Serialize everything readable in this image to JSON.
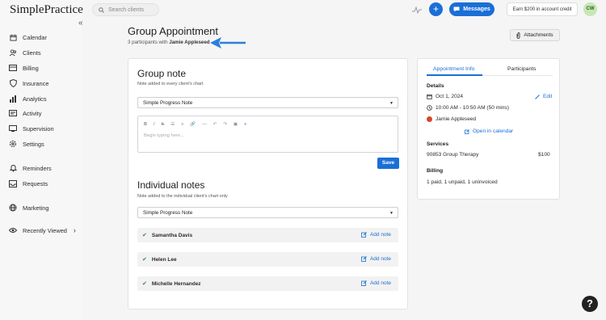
{
  "app": {
    "logo": "SimplePractice",
    "collapse_icon": "double-chevron-left-icon"
  },
  "sidebar": {
    "items": [
      {
        "label": "Calendar",
        "icon": "calendar-icon"
      },
      {
        "label": "Clients",
        "icon": "clients-icon"
      },
      {
        "label": "Billing",
        "icon": "billing-icon"
      },
      {
        "label": "Insurance",
        "icon": "shield-icon"
      },
      {
        "label": "Analytics",
        "icon": "analytics-icon"
      },
      {
        "label": "Activity",
        "icon": "activity-icon"
      },
      {
        "label": "Supervision",
        "icon": "supervision-icon"
      },
      {
        "label": "Settings",
        "icon": "gear-icon"
      },
      {
        "label": "Reminders",
        "icon": "bell-icon"
      },
      {
        "label": "Requests",
        "icon": "inbox-icon"
      },
      {
        "label": "Marketing",
        "icon": "globe-icon"
      },
      {
        "label": "Recently Viewed",
        "icon": "eye-icon"
      }
    ]
  },
  "topbar": {
    "search_placeholder": "Search clients",
    "plus_label": "+",
    "messages_label": "Messages",
    "earn_label": "Earn $200 in account credit",
    "avatar_initials": "CW"
  },
  "header": {
    "title": "Group Appointment",
    "subtitle_prefix": "3 participants with",
    "subtitle_client": "Jamie Appleseed",
    "attachments_label": "Attachments"
  },
  "group_note": {
    "title": "Group note",
    "subtitle": "Note added to every client's chart",
    "template": "Simple Progress Note",
    "placeholder": "Begin typing here...",
    "save_label": "Save",
    "toolbar": [
      "B",
      "I",
      "S",
      "☰",
      "≡",
      "🔗",
      "—",
      "↶",
      "↷",
      "▣",
      "+"
    ]
  },
  "individual_notes": {
    "title": "Individual notes",
    "subtitle": "Note added to the individual client's chart only",
    "template": "Simple Progress Note",
    "add_label": "Add note",
    "clients": [
      "Samantha Davis",
      "Helen Lee",
      "Michelle Hernandez"
    ]
  },
  "info_panel": {
    "tabs": [
      "Appointment Info",
      "Participants"
    ],
    "details_label": "Details",
    "date": "Oct 1, 2024",
    "edit_label": "Edit",
    "time": "10:00 AM - 10:50 AM (50 mins)",
    "client": "Jamie Appleseed",
    "calendar_link": "Open in calendar",
    "services_label": "Services",
    "service_name": "90853 Group Therapy",
    "service_price": "$100",
    "billing_label": "Billing",
    "billing_status": "1 paid, 1 unpaid, 1 uninvoiced"
  },
  "help_label": "?",
  "colors": {
    "accent": "#1a6fd6",
    "check": "#2e8b3e",
    "client_dot": "#d8452e"
  }
}
